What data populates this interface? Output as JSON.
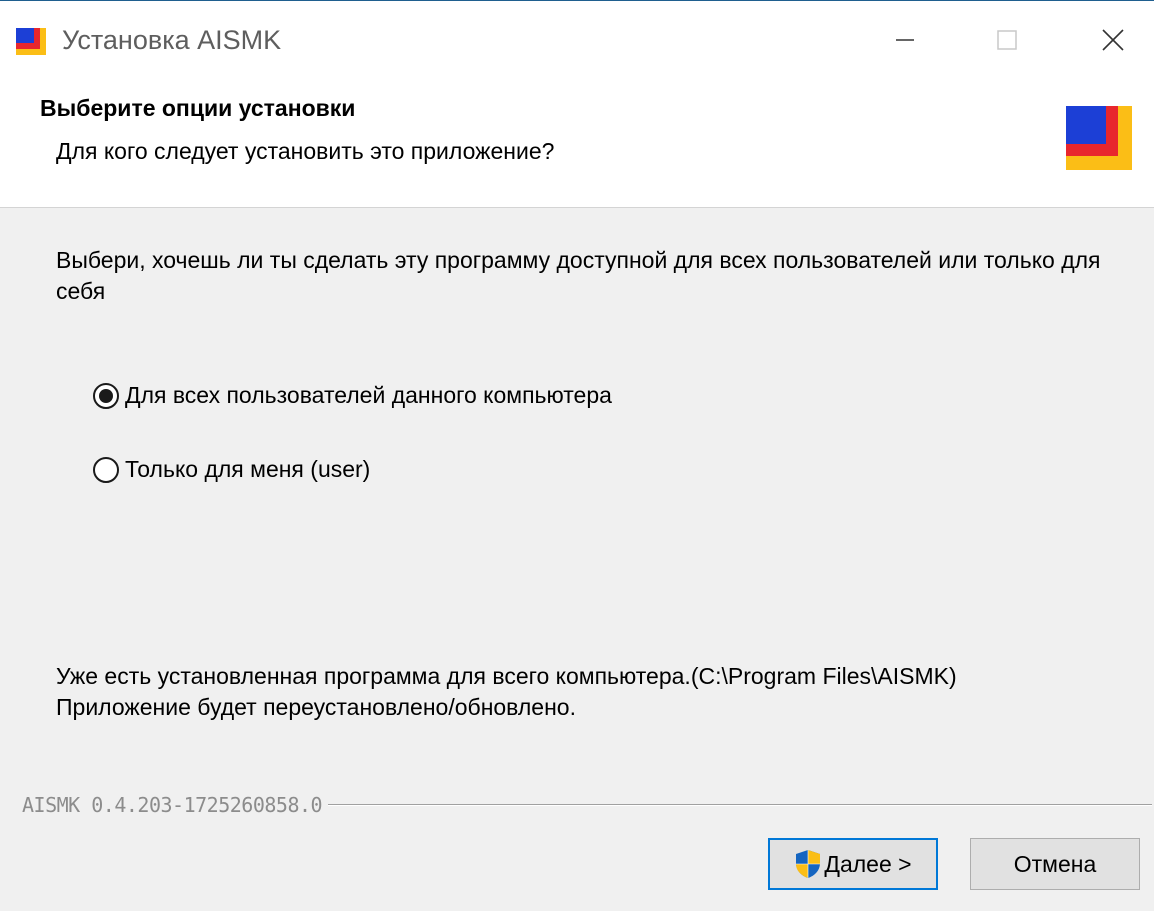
{
  "window": {
    "title": "Установка AISMK",
    "minimize_icon": "minimize-icon",
    "maximize_icon": "maximize-icon",
    "close_icon": "close-icon"
  },
  "header": {
    "title": "Выберите опции установки",
    "subtitle": "Для кого следует установить это приложение?"
  },
  "body": {
    "intro": "Выбери, хочешь ли ты сделать эту программу доступной для всех пользователей или только для себя",
    "options": [
      {
        "label": "Для всех пользователей данного компьютера",
        "selected": true
      },
      {
        "label": "Только для меня (user)",
        "selected": false
      }
    ],
    "notice_line1": "Уже есть установленная программа для всего компьютера.(C:\\Program Files\\AISMK)",
    "notice_line2": "Приложение будет переустановлено/обновлено."
  },
  "footer": {
    "version": "AISMK 0.4.203-1725260858.0",
    "next_label": "Далее >",
    "cancel_label": "Отмена"
  },
  "colors": {
    "accent": "#0078d7",
    "logo_blue": "#1c3fd6",
    "logo_red": "#e8262d",
    "logo_yellow": "#fbbe16"
  }
}
